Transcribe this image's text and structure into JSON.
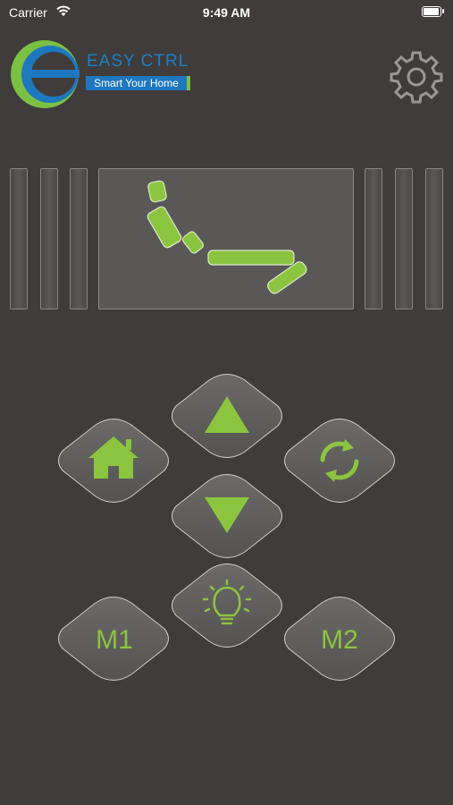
{
  "status_bar": {
    "carrier": "Carrier",
    "time": "9:49 AM",
    "wifi_icon": "wifi-icon",
    "battery_icon": "battery-icon"
  },
  "logo": {
    "brand": "EASY CTRL",
    "tagline": "Smart Your Home",
    "icon": "e-logo-icon"
  },
  "header": {
    "settings_icon": "gear-icon"
  },
  "bed_panel": {
    "icon": "adjustable-bed-icon"
  },
  "controls": {
    "up_icon": "arrow-up-icon",
    "down_icon": "arrow-down-icon",
    "home_icon": "home-icon",
    "refresh_icon": "refresh-icon",
    "light_icon": "light-bulb-icon",
    "m1_label": "M1",
    "m2_label": "M2"
  },
  "colors": {
    "background": "#3f3c3b",
    "accent_green": "#8bc53f",
    "brand_blue": "#1e77bf",
    "button_fill": "#5f5d5b"
  }
}
